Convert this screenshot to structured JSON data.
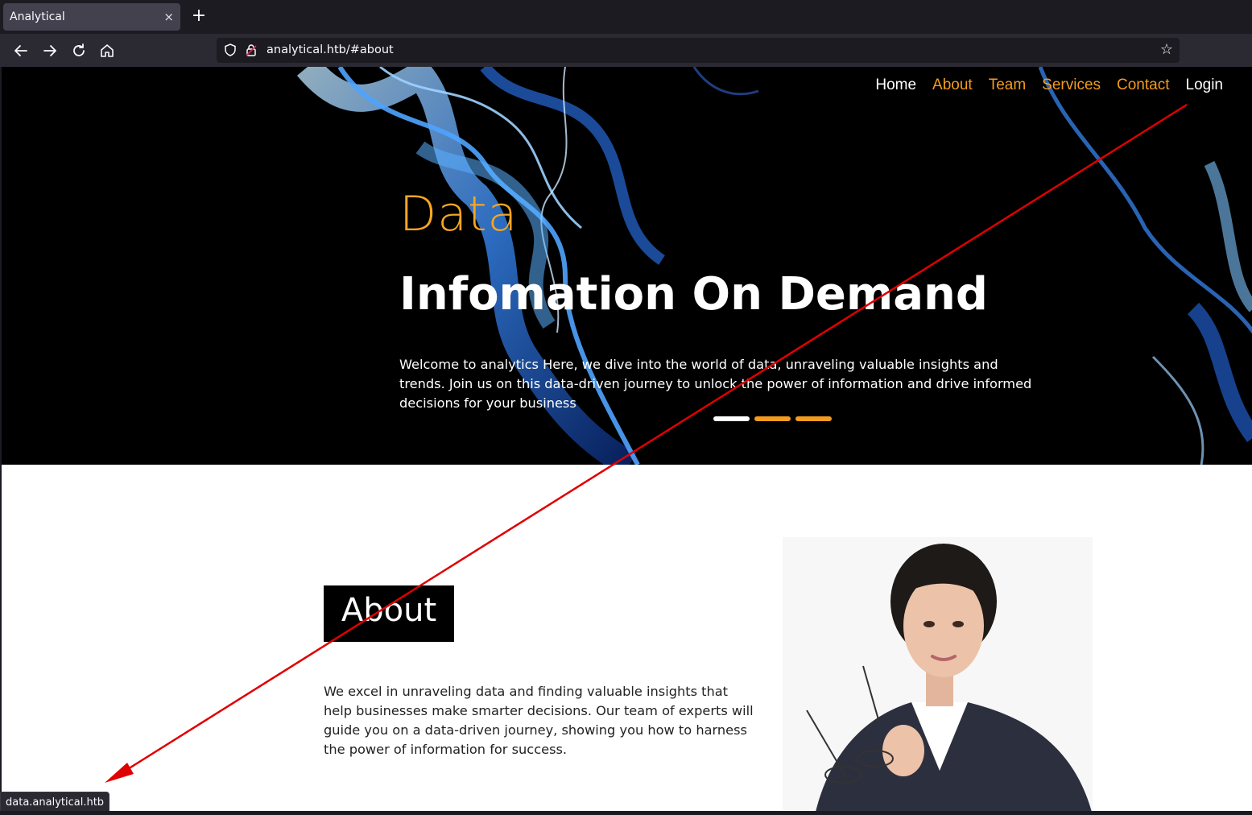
{
  "browser": {
    "tab_title": "Analytical",
    "tab_close": "×",
    "new_tab": "+",
    "url": "analytical.htb/#about",
    "status_url": "data.analytical.htb"
  },
  "site_nav": {
    "home": "Home",
    "about": "About",
    "team": "Team",
    "services": "Services",
    "contact": "Contact",
    "login": "Login"
  },
  "hero": {
    "kicker": "Data",
    "title": "Infomation On Demand",
    "text": "Welcome to analytics Here, we dive into the world of data, unraveling valuable insights and trends. Join us on this data-driven journey to unlock the power of information and drive informed decisions for your business"
  },
  "about": {
    "heading": "About",
    "text": "We excel in unraveling data and finding valuable insights that help businesses make smarter decisions. Our team of experts will guide you on a data-driven journey, showing you how to harness the power of information for success."
  },
  "colors": {
    "accent": "#f39c1f",
    "arrow": "#e00000",
    "hero_bg": "#000000",
    "chrome": "#2b2a33"
  }
}
